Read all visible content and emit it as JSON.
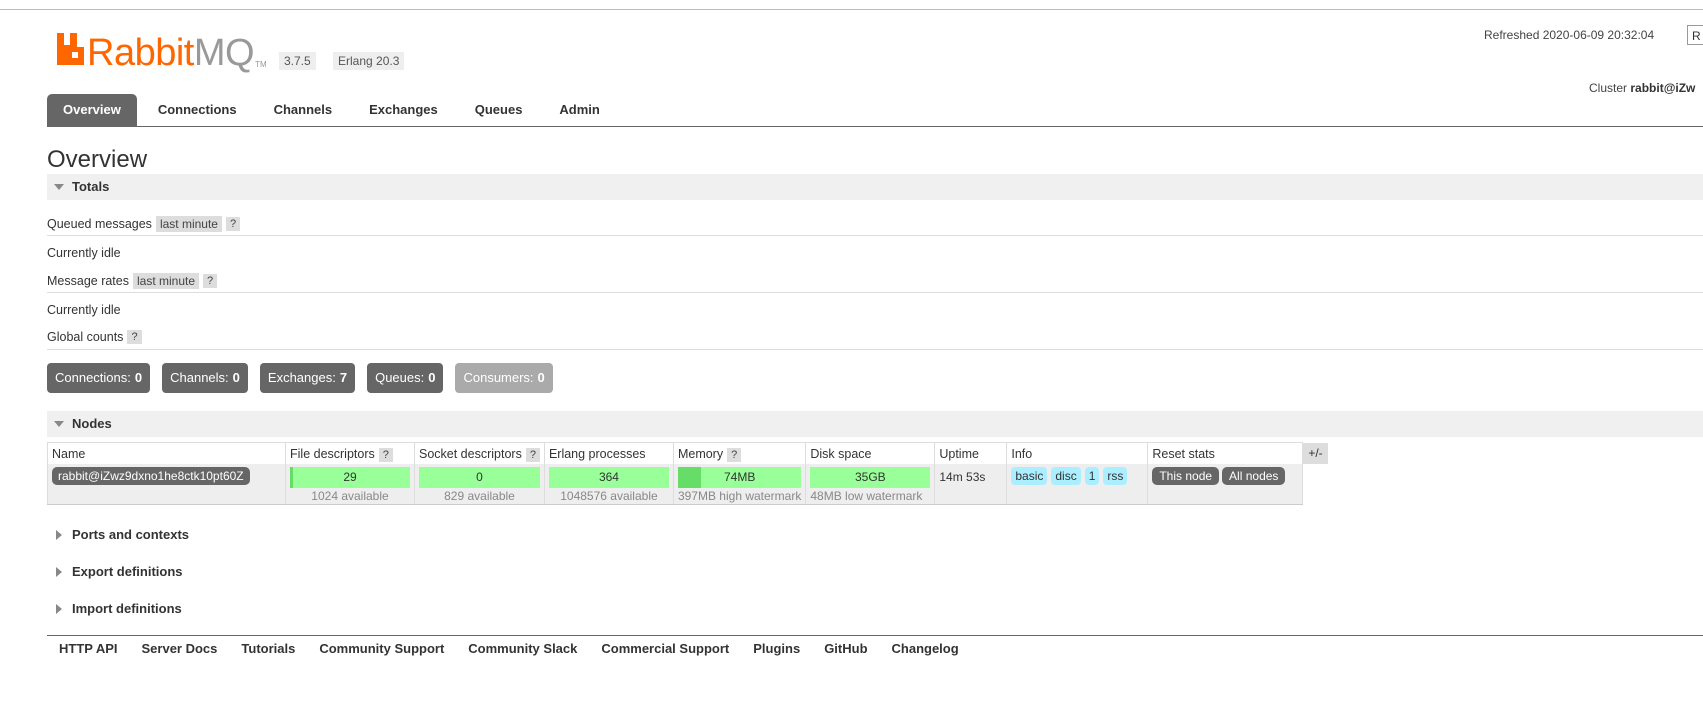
{
  "header": {
    "logo": {
      "rabbit": "Rabbit",
      "mq": "MQ",
      "tm": "TM"
    },
    "version": "3.7.5",
    "erlang": "Erlang 20.3",
    "refreshed": "Refreshed 2020-06-09 20:32:04",
    "refresh_select_value": "R",
    "cluster_label": "Cluster",
    "cluster_name": "rabbit@iZw"
  },
  "tabs": [
    "Overview",
    "Connections",
    "Channels",
    "Exchanges",
    "Queues",
    "Admin"
  ],
  "active_tab": "Overview",
  "page_title": "Overview",
  "totals": {
    "heading": "Totals",
    "queued_label": "Queued messages",
    "queued_range": "last minute",
    "help": "?",
    "queued_status": "Currently idle",
    "rates_label": "Message rates",
    "rates_range": "last minute",
    "rates_status": "Currently idle",
    "global_label": "Global counts"
  },
  "counts": [
    {
      "label": "Connections:",
      "value": "0"
    },
    {
      "label": "Channels:",
      "value": "0"
    },
    {
      "label": "Exchanges:",
      "value": "7"
    },
    {
      "label": "Queues:",
      "value": "0"
    },
    {
      "label": "Consumers:",
      "value": "0"
    }
  ],
  "nodes": {
    "heading": "Nodes",
    "columns": {
      "name": "Name",
      "file_descriptors": "File descriptors",
      "socket_descriptors": "Socket descriptors",
      "erlang_processes": "Erlang processes",
      "memory": "Memory",
      "disk_space": "Disk space",
      "uptime": "Uptime",
      "info": "Info",
      "reset_stats": "Reset stats",
      "plus_minus": "+/-"
    },
    "row": {
      "name": "rabbit@iZwz9dxno1he8ctk10pt60Z",
      "fd_used": "29",
      "fd_available": "1024 available",
      "fd_fraction": 0.028,
      "sockets_used": "0",
      "sockets_available": "829 available",
      "sockets_fraction": 0.0,
      "processes_used": "364",
      "processes_available": "1048576 available",
      "processes_fraction": 0.0003,
      "memory_used": "74MB",
      "memory_watermark": "397MB high watermark",
      "memory_fraction": 0.19,
      "disk_free": "35GB",
      "disk_watermark": "48MB low watermark",
      "uptime": "14m 53s",
      "info_tags": [
        "basic",
        "disc",
        "1",
        "rss"
      ],
      "reset_buttons": [
        "This node",
        "All nodes"
      ]
    }
  },
  "collapsed_sections": [
    "Ports and contexts",
    "Export definitions",
    "Import definitions"
  ],
  "footer_links": [
    "HTTP API",
    "Server Docs",
    "Tutorials",
    "Community Support",
    "Community Slack",
    "Commercial Support",
    "Plugins",
    "GitHub",
    "Changelog"
  ],
  "colors": {
    "brand": "#ff6600",
    "tab_active": "#666666",
    "bar": "#99ff99",
    "bar_fill": "#66dd66",
    "tag": "#aaeeff"
  }
}
